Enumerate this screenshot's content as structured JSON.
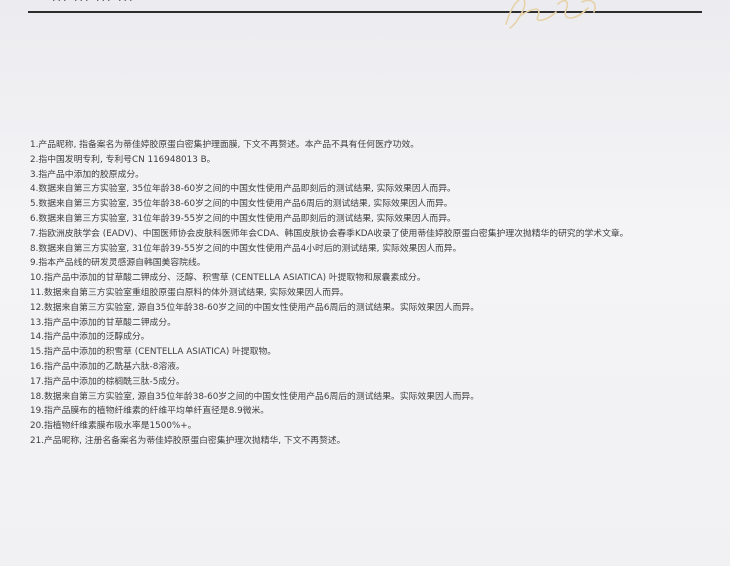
{
  "header": {
    "cut_text": "... ... ... ..."
  },
  "footnotes": [
    "1.产品昵称, 指备案名为蒂佳婷胶原蛋白密集护理面膜, 下文不再赘述。本产品不具有任何医疗功效。",
    "2.指中国发明专利, 专利号CN 116948013 B。",
    "3.指产品中添加的胶原成分。",
    "4.数据来自第三方实验室, 35位年龄38-60岁之间的中国女性使用产品即刻后的测试结果, 实际效果因人而异。",
    "5.数据来自第三方实验室, 35位年龄38-60岁之间的中国女性使用产品6周后的测试结果, 实际效果因人而异。",
    "6.数据来自第三方实验室, 31位年龄39-55岁之间的中国女性使用产品即刻后的测试结果, 实际效果因人而异。",
    "7.指欧洲皮肤学会 (EADV)、中国医师协会皮肤科医师年会CDA、韩国皮肤协会春季KDA收录了使用蒂佳婷胶原蛋白密集护理次抛精华的研究的学术文章。",
    "8.数据来自第三方实验室, 31位年龄39-55岁之间的中国女性使用产品4小时后的测试结果, 实际效果因人而异。",
    "9.指本产品线的研发灵感源自韩国美容院线。",
    "10.指产品中添加的甘草酸二钾成分、泛醇、积雪草 (CENTELLA ASIATICA) 叶提取物和尿囊素成分。",
    "11.数据来自第三方实验室重组胶原蛋白原料的体外测试结果, 实际效果因人而异。",
    "12.数据来自第三方实验室, 源自35位年龄38-60岁之间的中国女性使用产品6周后的测试结果。实际效果因人而异。",
    "13.指产品中添加的甘草酸二钾成分。",
    "14.指产品中添加的泛醇成分。",
    "15.指产品中添加的积雪草 (CENTELLA ASIATICA) 叶提取物。",
    "16.指产品中添加的乙酰基六肽-8溶液。",
    "17.指产品中添加的棕榈酰三肽-5成分。",
    "18.数据来自第三方实验室, 源自35位年龄38-60岁之间的中国女性使用产品6周后的测试结果。实际效果因人而异。",
    "19.指产品膜布的植物纤维素的纤维平均单纤直径是8.9微米。",
    "20.指植物纤维素膜布吸水率是1500%+。",
    "21.产品昵称, 注册名备案名为蒂佳婷胶原蛋白密集护理次抛精华, 下文不再赘述。"
  ]
}
